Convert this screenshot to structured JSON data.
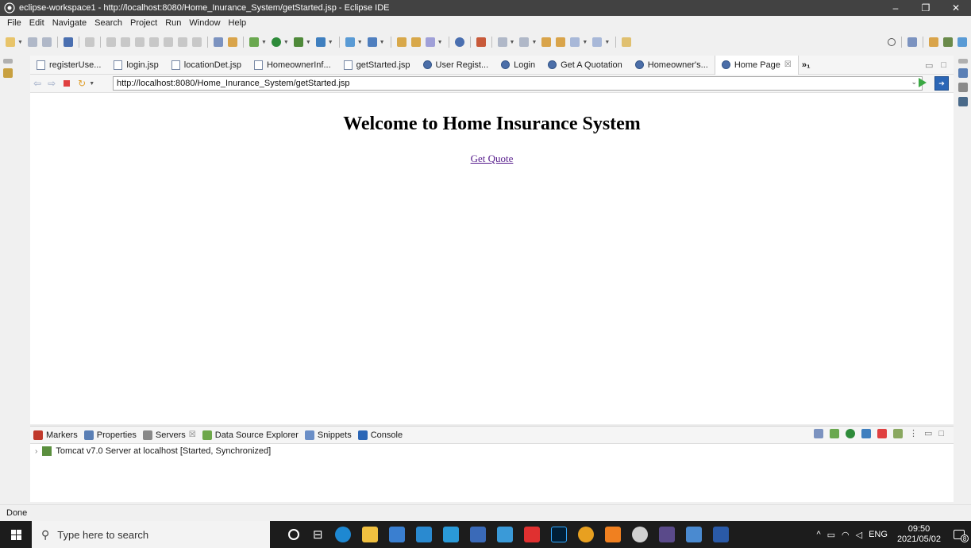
{
  "window": {
    "title": "eclipse-workspace1 - http://localhost:8080/Home_Inurance_System/getStarted.jsp - Eclipse IDE",
    "minimize": "–",
    "maximize": "❐",
    "close": "✕"
  },
  "menu": [
    "File",
    "Edit",
    "Navigate",
    "Search",
    "Project",
    "Run",
    "Window",
    "Help"
  ],
  "editor_tabs": [
    {
      "label": "registerUse...",
      "icon": "jsp-file-icon"
    },
    {
      "label": "login.jsp",
      "icon": "jsp-file-icon"
    },
    {
      "label": "locationDet.jsp",
      "icon": "jsp-file-icon"
    },
    {
      "label": "HomeownerInf...",
      "icon": "jsp-file-icon"
    },
    {
      "label": "getStarted.jsp",
      "icon": "jsp-file-icon"
    },
    {
      "label": "User Regist...",
      "icon": "globe-icon"
    },
    {
      "label": "Login",
      "icon": "globe-icon"
    },
    {
      "label": "Get A Quotation",
      "icon": "globe-icon"
    },
    {
      "label": "Homeowner's...",
      "icon": "globe-icon"
    },
    {
      "label": "Home Page",
      "icon": "globe-icon",
      "active": true,
      "close": "☒"
    }
  ],
  "tab_overflow": "»₁",
  "browser": {
    "url": "http://localhost:8080/Home_Inurance_System/getStarted.jsp",
    "page_heading": "Welcome to Home Insurance System",
    "link_text": "Get Quote"
  },
  "bottom_tabs": [
    {
      "label": "Markers",
      "icon": "markers-icon",
      "color": "#c0392b"
    },
    {
      "label": "Properties",
      "icon": "properties-icon",
      "color": "#5a7fb5"
    },
    {
      "label": "Servers",
      "icon": "servers-icon",
      "color": "#888888",
      "active": true,
      "close": "☒"
    },
    {
      "label": "Data Source Explorer",
      "icon": "data-source-icon",
      "color": "#6ea84a"
    },
    {
      "label": "Snippets",
      "icon": "snippets-icon",
      "color": "#6b8fc7"
    },
    {
      "label": "Console",
      "icon": "console-icon",
      "color": "#2b66b6"
    }
  ],
  "server": {
    "label": "Tomcat v7.0 Server at localhost  [Started, Synchronized]"
  },
  "status": "Done",
  "taskbar": {
    "search_placeholder": "Type here to search",
    "language": "ENG",
    "time": "09:50",
    "date": "2021/05/02",
    "notifications": "8"
  },
  "colors": {
    "titlebar": "#424242",
    "taskbar": "#1c1c1c",
    "link_visited": "#551a8b"
  }
}
